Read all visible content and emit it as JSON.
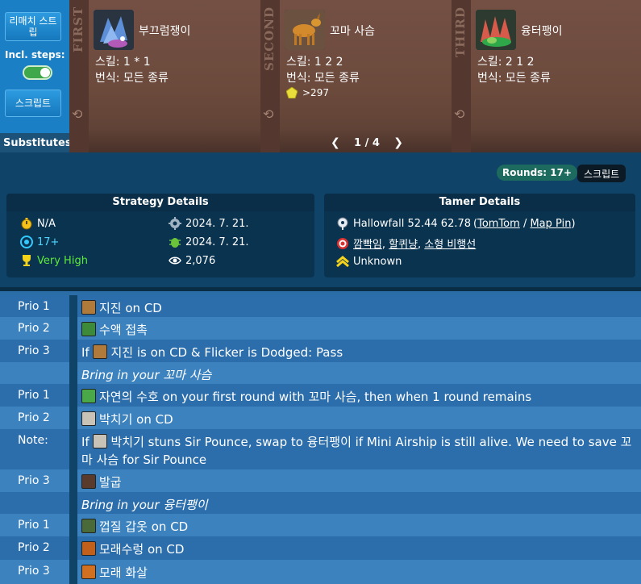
{
  "sidebar": {
    "rematch_label": "리매치 스트립",
    "incl_steps_label": "Incl. steps:",
    "script_label": "스크립트",
    "substitutes_label": "Substitutes:"
  },
  "pets": [
    {
      "ordinal": "FIRST",
      "name": "부끄럼쟁이",
      "skills": "스킬: 1 * 1",
      "breed": "번식: 모든 종류",
      "level": ""
    },
    {
      "ordinal": "SECOND",
      "name": "꼬마 사슴",
      "skills": "스킬: 1 2 2",
      "breed": "번식: 모든 종류",
      "level": ">297"
    },
    {
      "ordinal": "THIRD",
      "name": "융터팽이",
      "skills": "스킬: 2 1 2",
      "breed": "번식: 모든 종류",
      "level": ""
    }
  ],
  "pager": {
    "text": "1 / 4"
  },
  "badges": {
    "rounds": "Rounds: 17+",
    "script": "스크립트"
  },
  "strategy": {
    "title": "Strategy Details",
    "left": [
      {
        "icon": "stopwatch-icon",
        "text": "N/A"
      },
      {
        "icon": "target-icon",
        "text": "17+"
      },
      {
        "icon": "trophy-icon",
        "text": "Very High"
      }
    ],
    "right": [
      {
        "icon": "gear-icon",
        "text": "2024. 7. 21."
      },
      {
        "icon": "bug-icon",
        "text": "2024. 7. 21."
      },
      {
        "icon": "eye-icon",
        "text": "2,076"
      }
    ]
  },
  "tamer": {
    "title": "Tamer Details",
    "location": "Hallowfall 52.44 62.78",
    "tomtom": "TomTom",
    "sep": "/",
    "mappin": "Map Pin",
    "paren_open": "(",
    "paren_close": ")",
    "enemies": [
      "깜빡임",
      "할퀴냥",
      "소형 비행선"
    ],
    "enemy_sep": ", ",
    "level": "Unknown"
  },
  "steps": [
    {
      "prio": "Prio 1",
      "pre": "",
      "spell": "지진",
      "post": " on CD",
      "kind": "odd"
    },
    {
      "prio": "Prio 2",
      "pre": "",
      "spell": "수액 접촉",
      "post": "",
      "kind": "even"
    },
    {
      "prio": "Prio 3",
      "pre": "If ",
      "spell": "지진",
      "post": " is on CD & Flicker is Dodged: Pass",
      "kind": "odd"
    },
    {
      "prio": "",
      "bring": "Bring in your 꼬마 사슴",
      "kind": "even"
    },
    {
      "prio": "Prio 1",
      "pre": "",
      "spell": "자연의 수호",
      "post": " on your first round with 꼬마 사슴, then when 1 round remains",
      "kind": "odd"
    },
    {
      "prio": "Prio 2",
      "pre": "",
      "spell": "박치기",
      "post": " on CD",
      "kind": "even"
    },
    {
      "prio": "Note:",
      "pre": "If ",
      "spell": "박치기",
      "post": " stuns Sir Pounce, swap to 융터팽이 if Mini Airship is still alive. We need to save 꼬마 사슴 for Sir Pounce",
      "kind": "odd"
    },
    {
      "prio": "Prio 3",
      "pre": "",
      "spell": "발굽",
      "post": "",
      "kind": "even"
    },
    {
      "prio": "",
      "bring": "Bring in your 융터팽이",
      "kind": "odd"
    },
    {
      "prio": "Prio 1",
      "pre": "",
      "spell": "껍질 갑옷",
      "post": " on CD",
      "kind": "even"
    },
    {
      "prio": "Prio 2",
      "pre": "",
      "spell": "모래수렁",
      "post": " on CD",
      "kind": "odd"
    },
    {
      "prio": "Prio 3",
      "pre": "",
      "spell": "모래 화살",
      "post": "",
      "kind": "even"
    }
  ]
}
